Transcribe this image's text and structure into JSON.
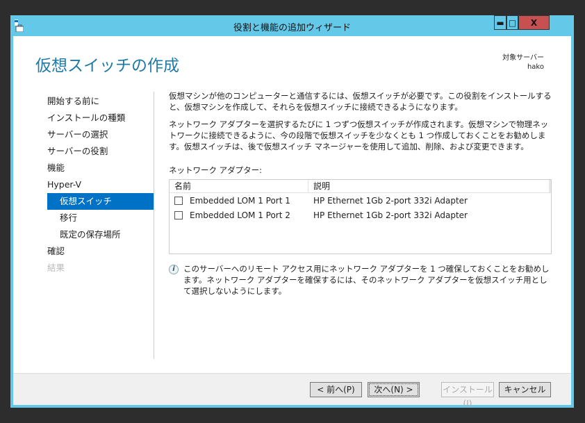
{
  "window": {
    "title": "役割と機能の追加ウィザード",
    "minimize": "▬",
    "maximize": "□",
    "close": "X"
  },
  "header": {
    "title": "仮想スイッチの作成",
    "target_label": "対象サーバー",
    "target_value": "hako"
  },
  "sidebar": {
    "items": [
      {
        "label": "開始する前に"
      },
      {
        "label": "インストールの種類"
      },
      {
        "label": "サーバーの選択"
      },
      {
        "label": "サーバーの役割"
      },
      {
        "label": "機能"
      },
      {
        "label": "Hyper-V"
      },
      {
        "label": "仮想スイッチ",
        "selected": true
      },
      {
        "label": "移行"
      },
      {
        "label": "既定の保存場所"
      },
      {
        "label": "確認"
      },
      {
        "label": "結果",
        "disabled": true
      }
    ]
  },
  "main": {
    "para1": "仮想マシンが他のコンピューターと通信するには、仮想スイッチが必要です。この役割をインストールすると、仮想マシンを作成して、それらを仮想スイッチに接続できるようになります。",
    "para2": "ネットワーク アダプターを選択するたびに 1 つずつ仮想スイッチが作成されます。仮想マシンで物理ネットワークに接続できるように、今の段階で仮想スイッチを少なくとも 1 つ作成しておくことをお勧めします。仮想スイッチは、後で仮想スイッチ マネージャーを使用して追加、削除、および変更できます。",
    "adapters_label": "ネットワーク アダプター:",
    "columns": [
      "名前",
      "説明"
    ],
    "rows": [
      {
        "name": "Embedded LOM 1 Port 1",
        "description": "HP Ethernet 1Gb 2-port 332i Adapter",
        "checked": false
      },
      {
        "name": "Embedded LOM 1 Port 2",
        "description": "HP Ethernet 1Gb 2-port 332i Adapter",
        "checked": false
      }
    ],
    "info": "このサーバーへのリモート アクセス用にネットワーク アダプターを 1 つ確保しておくことをお勧めします。ネットワーク アダプターを確保するには、そのネットワーク アダプターを仮想スイッチ用として選択しないようにします。",
    "info_icon": "i"
  },
  "footer": {
    "prev": "< 前へ(P)",
    "next": "次へ(N) >",
    "install": "インストール(I)",
    "cancel": "キャンセル"
  },
  "colors": {
    "accent": "#0072c6",
    "frame": "#64c8e8",
    "title": "#1f7aa6"
  }
}
